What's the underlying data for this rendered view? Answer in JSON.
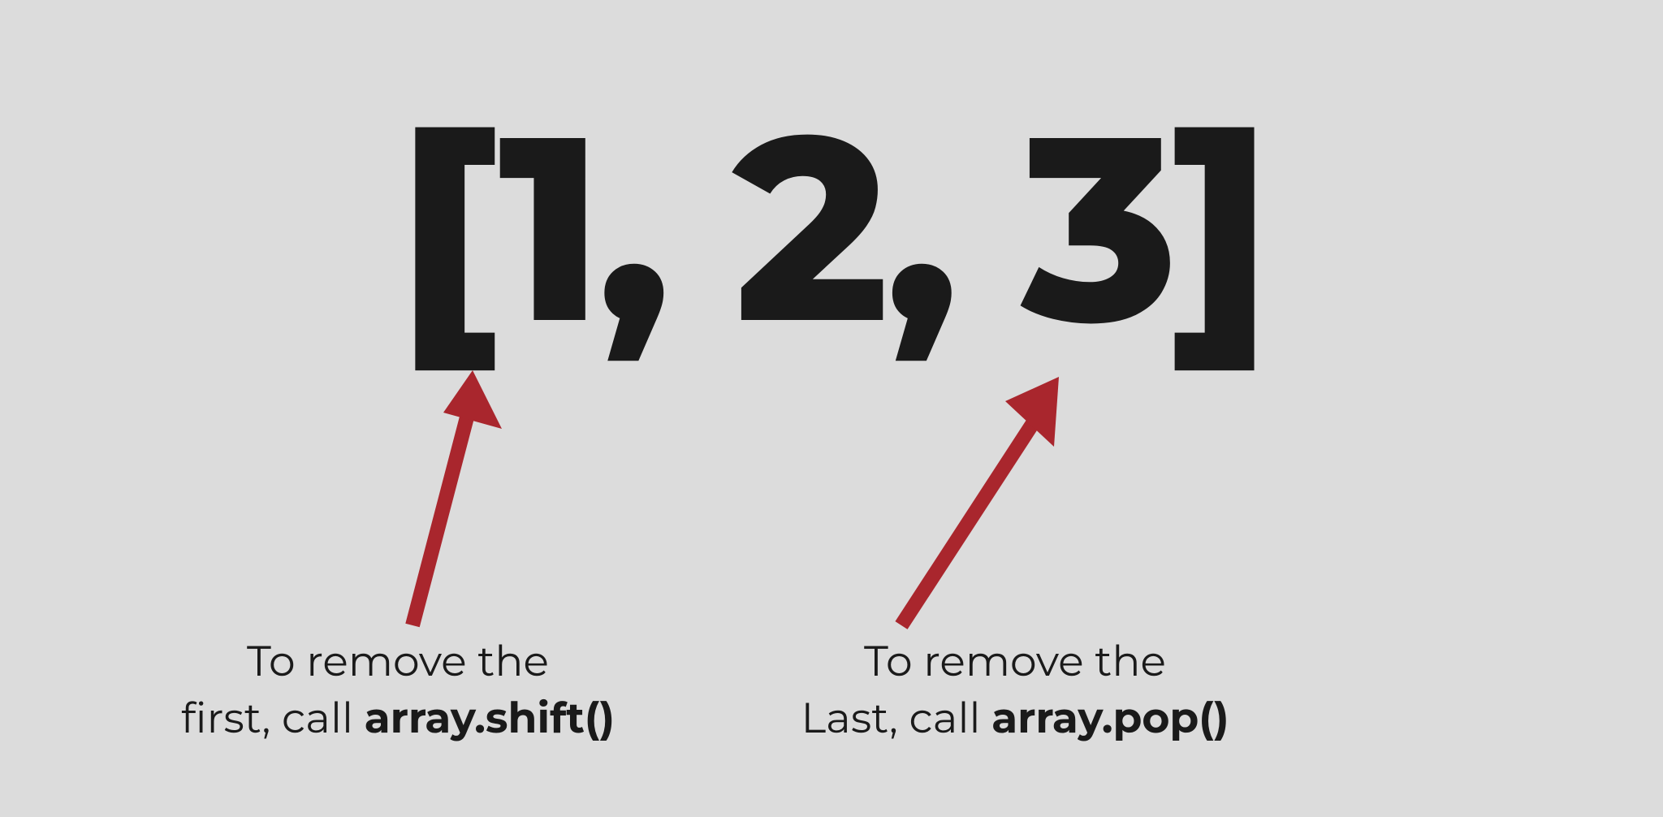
{
  "array_display": "[1, 2, 3]",
  "captions": {
    "left": {
      "line1": "To remove the",
      "line2_prefix": "first, call ",
      "line2_bold": "array.shift()"
    },
    "right": {
      "line1": "To remove the",
      "line2_prefix": "Last, call ",
      "line2_bold": "array.pop()"
    }
  },
  "colors": {
    "background": "#dcdcdc",
    "text": "#1a1a1a",
    "arrow": "#A9262D"
  }
}
